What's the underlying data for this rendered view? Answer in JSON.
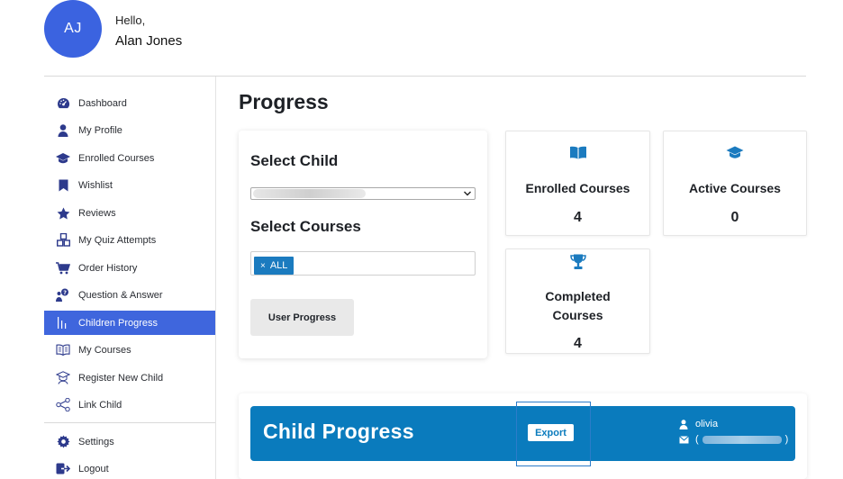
{
  "user": {
    "initials": "AJ",
    "greeting": "Hello,",
    "name": "Alan Jones"
  },
  "sidebar": {
    "items": [
      {
        "label": "Dashboard",
        "icon": "dashboard-icon"
      },
      {
        "label": "My Profile",
        "icon": "user-icon"
      },
      {
        "label": "Enrolled Courses",
        "icon": "graduation-cap-icon"
      },
      {
        "label": "Wishlist",
        "icon": "bookmark-icon"
      },
      {
        "label": "Reviews",
        "icon": "star-icon"
      },
      {
        "label": "My Quiz Attempts",
        "icon": "quiz-blocks-icon"
      },
      {
        "label": "Order History",
        "icon": "cart-icon"
      },
      {
        "label": "Question & Answer",
        "icon": "question-answer-icon"
      },
      {
        "label": "Children Progress",
        "icon": "bar-chart-icon",
        "active": true
      },
      {
        "label": "My Courses",
        "icon": "book-open-icon"
      },
      {
        "label": "Register New Child",
        "icon": "register-child-icon"
      },
      {
        "label": "Link Child",
        "icon": "share-link-icon"
      }
    ],
    "bottom_items": [
      {
        "label": "Settings",
        "icon": "gear-icon"
      },
      {
        "label": "Logout",
        "icon": "logout-icon"
      }
    ],
    "active_color": "#3f66dd"
  },
  "main": {
    "title": "Progress",
    "select_child_label": "Select Child",
    "select_courses_label": "Select Courses",
    "course_tag": {
      "remove": "×",
      "label": "ALL"
    },
    "user_progress_button": "User Progress",
    "stats": {
      "enrolled": {
        "label": "Enrolled Courses",
        "value": "4",
        "icon": "book-open-icon"
      },
      "active": {
        "label": "Active Courses",
        "value": "0",
        "icon": "graduation-cap-icon"
      },
      "completed": {
        "label_line1": "Completed",
        "label_line2": "Courses",
        "value": "4",
        "icon": "trophy-icon"
      }
    },
    "icon_color": "#1b7bbf"
  },
  "child_progress": {
    "title": "Child Progress",
    "export_button": "Export",
    "username": "olivia",
    "email_prefix": "(",
    "email_suffix": ")",
    "banner_color": "#0a7bbd"
  }
}
